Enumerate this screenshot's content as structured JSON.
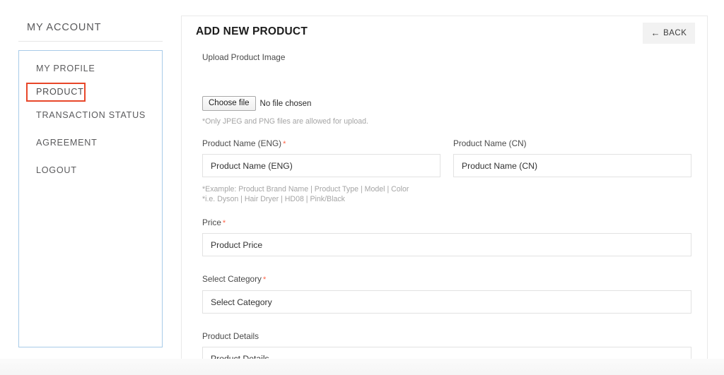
{
  "sidebar": {
    "heading": "MY ACCOUNT",
    "items": [
      {
        "label": "MY PROFILE",
        "active": false
      },
      {
        "label": "PRODUCT",
        "active": true
      },
      {
        "label": "TRANSACTION STATUS",
        "active": false
      },
      {
        "label": "AGREEMENT",
        "active": false
      },
      {
        "label": "LOGOUT",
        "active": false
      }
    ],
    "active_border_color": "#e8472a",
    "box_border_color": "#a8cbe8"
  },
  "main": {
    "title": "ADD NEW PRODUCT",
    "back_button": {
      "label": "BACK",
      "arrow_glyph": "←"
    },
    "upload": {
      "label": "Upload Product Image",
      "choose_file_label": "Choose file",
      "no_file_text": "No file chosen",
      "note": "*Only JPEG and PNG files are allowed for upload."
    },
    "fields": {
      "name_eng": {
        "label": "Product Name (ENG)",
        "required_marker": "*",
        "placeholder": "Product Name (ENG)",
        "value": ""
      },
      "name_cn": {
        "label": "Product Name (CN)",
        "required_marker": "",
        "placeholder": "Product Name (CN)",
        "value": ""
      },
      "example_note_line1": "*Example: Product Brand Name | Product Type | Model | Color",
      "example_note_line2": "*i.e. Dyson | Hair Dryer | HD08 | Pink/Black",
      "price": {
        "label": "Price",
        "required_marker": "*",
        "placeholder": "Product Price",
        "value": ""
      },
      "category": {
        "label": "Select Category",
        "required_marker": "*",
        "placeholder": "Select Category",
        "value": ""
      },
      "details": {
        "label": "Product Details",
        "required_marker": "",
        "placeholder": "Product Details",
        "value": ""
      }
    }
  },
  "colors": {
    "accent_red": "#e8472a",
    "required_asterisk": "#ff6347",
    "panel_border": "#e9e9e9",
    "input_border": "#e2e2e2",
    "back_button_bg": "#f2f2f2"
  }
}
